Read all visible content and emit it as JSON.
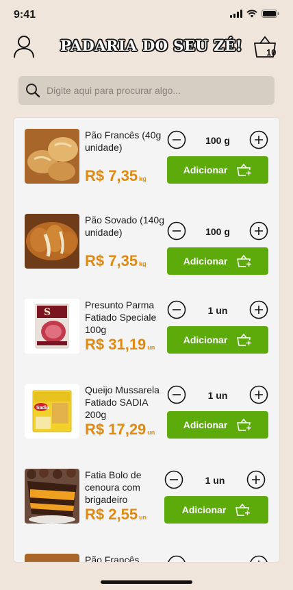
{
  "status": {
    "time": "9:41"
  },
  "header": {
    "logo_text": "PADARIA DO SEU ZÉ!",
    "cart_count": "10"
  },
  "search": {
    "placeholder": "Digite aqui para procurar algo..."
  },
  "colors": {
    "background": "#efe5db",
    "accent_green": "#5cab0b",
    "price_orange": "#e08a12",
    "search_bg": "#d6cdc3"
  },
  "products": [
    {
      "name": "Pão Francês (40g unidade)",
      "price": "R$ 7,35",
      "unit": "kg",
      "qty": "100 g",
      "add_label": "Adicionar",
      "image": "french-bread-photo"
    },
    {
      "name": "Pão Sovado (140g unidade)",
      "price": "R$ 7,35",
      "unit": "kg",
      "qty": "100 g",
      "add_label": "Adicionar",
      "image": "sweet-bread-photo"
    },
    {
      "name": "Presunto Parma Fatiado Speciale 100g",
      "price": "R$ 31,19",
      "unit": "un",
      "qty": "1 un",
      "add_label": "Adicionar",
      "image": "parma-ham-package-photo"
    },
    {
      "name": "Queijo Mussarela Fatiado SADIA 200g",
      "price": "R$ 17,29",
      "unit": "un",
      "qty": "1 un",
      "add_label": "Adicionar",
      "image": "mozzarella-package-photo"
    },
    {
      "name": "Fatia Bolo de cenoura com brigadeiro",
      "price": "R$ 2,55",
      "unit": "un",
      "qty": "1 un",
      "add_label": "Adicionar",
      "image": "carrot-cake-photo"
    },
    {
      "name": "Pão Francês",
      "image": "french-bread-photo"
    }
  ],
  "icons": {
    "profile": "user-icon",
    "cart": "basket-icon",
    "search": "search-icon",
    "minus": "minus-circle-icon",
    "plus": "plus-circle-icon",
    "add_to_cart": "basket-plus-icon"
  }
}
